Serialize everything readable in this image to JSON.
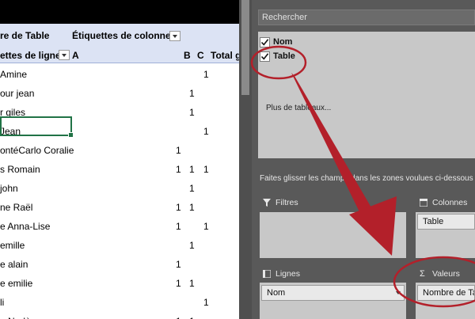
{
  "sheet": {
    "header_values_title": "re de Table",
    "header_columns_title": "Étiquettes de colonnes",
    "header_rows_title": "ettes de lignes",
    "col_a": "A",
    "col_b": "B",
    "col_c": "C",
    "col_total": "Total g",
    "rows": [
      {
        "label": "Amine",
        "a": "",
        "b": "",
        "c": "",
        "total": "1"
      },
      {
        "label": "our jean",
        "a": "",
        "b": "1",
        "c": "",
        "total": ""
      },
      {
        "label": "r giles",
        "a": "",
        "b": "1",
        "c": "",
        "total": ""
      },
      {
        "label": "Jean",
        "a": "",
        "b": "",
        "c": "",
        "total": "1"
      },
      {
        "label": "ontéCarlo Coralie",
        "a": "1",
        "b": "",
        "c": "",
        "total": ""
      },
      {
        "label": "s Romain",
        "a": "1",
        "b": "1",
        "c": "",
        "total": "1"
      },
      {
        "label": "john",
        "a": "",
        "b": "1",
        "c": "",
        "total": ""
      },
      {
        "label": "ne Raël",
        "a": "1",
        "b": "1",
        "c": "",
        "total": ""
      },
      {
        "label": "e Anna-Lise",
        "a": "1",
        "b": "",
        "c": "",
        "total": "1"
      },
      {
        "label": "emille",
        "a": "",
        "b": "1",
        "c": "",
        "total": ""
      },
      {
        "label": "e alain",
        "a": "1",
        "b": "",
        "c": "",
        "total": ""
      },
      {
        "label": "e emilie",
        "a": "1",
        "b": "1",
        "c": "",
        "total": ""
      },
      {
        "label": "li",
        "a": "",
        "b": "",
        "c": "",
        "total": "1"
      },
      {
        "label": "e Nadège",
        "a": "1",
        "b": "1",
        "c": "",
        "total": ""
      }
    ]
  },
  "pane": {
    "search_placeholder": "Rechercher",
    "fields": [
      {
        "label": "Nom",
        "checked": true
      },
      {
        "label": "Table",
        "checked": true
      }
    ],
    "more_tables": "Plus de tableaux...",
    "instructions": "Faites glisser les champs dans les zones voulues ci-dessous :",
    "zones": {
      "filters_title": "Filtres",
      "columns_title": "Colonnes",
      "rows_title": "Lignes",
      "values_title": "Valeurs",
      "columns_chip": "Table",
      "rows_chip": "Nom",
      "values_chip": "Nombre de Table"
    },
    "icons": [
      "filter-icon",
      "columns-icon",
      "rows-icon",
      "sigma-icon",
      "checkbox-checked-icon",
      "dropdown-arrow-icon"
    ]
  },
  "annotation": {
    "color": "#b3202a"
  }
}
